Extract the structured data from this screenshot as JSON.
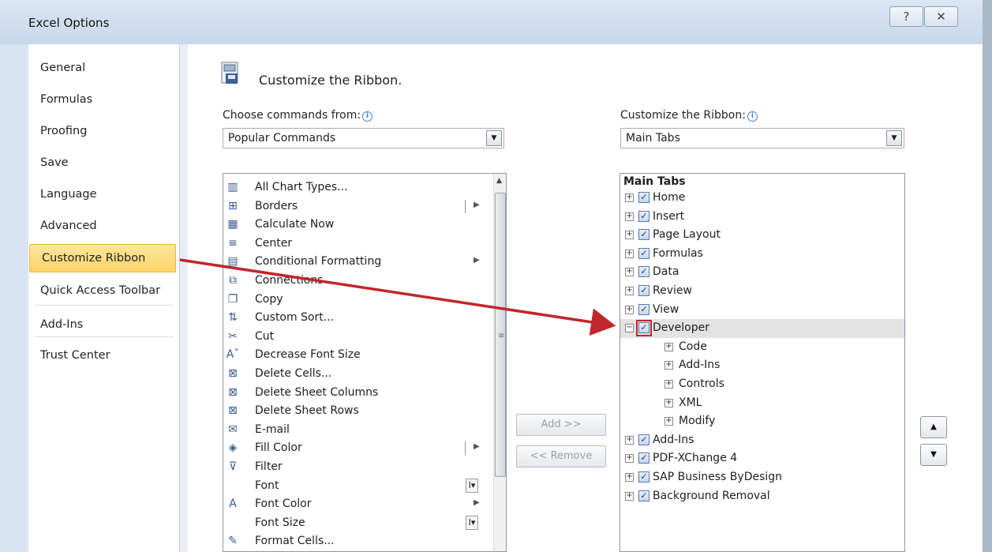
{
  "window": {
    "title": "Excel Options",
    "help_glyph": "?",
    "close_glyph": "✕"
  },
  "nav": {
    "items": [
      {
        "label": "General"
      },
      {
        "label": "Formulas"
      },
      {
        "label": "Proofing"
      },
      {
        "label": "Save"
      },
      {
        "label": "Language"
      },
      {
        "label": "Advanced"
      },
      {
        "label": "Customize Ribbon",
        "selected": true
      },
      {
        "label": "Quick Access Toolbar"
      },
      {
        "label": "Add-Ins"
      },
      {
        "label": "Trust Center"
      }
    ]
  },
  "header": {
    "title": "Customize the Ribbon."
  },
  "left": {
    "label": "Choose commands from:",
    "combo_value": "Popular Commands",
    "commands": [
      {
        "label": "All Chart Types...",
        "icon": "chart-icon",
        "glyph": "▥"
      },
      {
        "label": "Borders",
        "icon": "borders-icon",
        "glyph": "⊞",
        "submenu": true,
        "sep": true
      },
      {
        "label": "Calculate Now",
        "icon": "calculator-icon",
        "glyph": "▦"
      },
      {
        "label": "Center",
        "icon": "align-center-icon",
        "glyph": "≡"
      },
      {
        "label": "Conditional Formatting",
        "icon": "conditional-formatting-icon",
        "glyph": "▤",
        "submenu": true
      },
      {
        "label": "Connections",
        "icon": "connections-icon",
        "glyph": "⧉"
      },
      {
        "label": "Copy",
        "icon": "copy-icon",
        "glyph": "❐"
      },
      {
        "label": "Custom Sort...",
        "icon": "sort-icon",
        "glyph": "⇅"
      },
      {
        "label": "Cut",
        "icon": "scissors-icon",
        "glyph": "✂"
      },
      {
        "label": "Decrease Font Size",
        "icon": "decrease-font-icon",
        "glyph": "Aˇ"
      },
      {
        "label": "Delete Cells...",
        "icon": "delete-cells-icon",
        "glyph": "⊠"
      },
      {
        "label": "Delete Sheet Columns",
        "icon": "delete-columns-icon",
        "glyph": "⊠"
      },
      {
        "label": "Delete Sheet Rows",
        "icon": "delete-rows-icon",
        "glyph": "⊠"
      },
      {
        "label": "E-mail",
        "icon": "email-icon",
        "glyph": "✉"
      },
      {
        "label": "Fill Color",
        "icon": "fill-color-icon",
        "glyph": "◈",
        "submenu": true,
        "sep": true
      },
      {
        "label": "Filter",
        "icon": "filter-icon",
        "glyph": "⊽"
      },
      {
        "label": "Font",
        "icon": "",
        "glyph": "",
        "fontctl": true
      },
      {
        "label": "Font Color",
        "icon": "font-color-icon",
        "glyph": "A",
        "submenu": true
      },
      {
        "label": "Font Size",
        "icon": "",
        "glyph": "",
        "fontctl": true
      },
      {
        "label": "Format Cells...",
        "icon": "format-cells-icon",
        "glyph": "✎"
      }
    ]
  },
  "buttons": {
    "add": "Add >>",
    "remove": "<< Remove"
  },
  "right": {
    "label": "Customize the Ribbon:",
    "combo_value": "Main Tabs",
    "tree_header": "Main Tabs",
    "tabs": [
      {
        "label": "Home",
        "checked": true,
        "level": 0,
        "expander": "+"
      },
      {
        "label": "Insert",
        "checked": true,
        "level": 0,
        "expander": "+"
      },
      {
        "label": "Page Layout",
        "checked": true,
        "level": 0,
        "expander": "+"
      },
      {
        "label": "Formulas",
        "checked": true,
        "level": 0,
        "expander": "+"
      },
      {
        "label": "Data",
        "checked": true,
        "level": 0,
        "expander": "+"
      },
      {
        "label": "Review",
        "checked": true,
        "level": 0,
        "expander": "+"
      },
      {
        "label": "View",
        "checked": true,
        "level": 0,
        "expander": "+"
      },
      {
        "label": "Developer",
        "checked": true,
        "level": 0,
        "expander": "−",
        "selected": true,
        "highlighted": true
      },
      {
        "label": "Code",
        "level": 1,
        "expander": "+"
      },
      {
        "label": "Add-Ins",
        "level": 1,
        "expander": "+"
      },
      {
        "label": "Controls",
        "level": 1,
        "expander": "+"
      },
      {
        "label": "XML",
        "level": 1,
        "expander": "+"
      },
      {
        "label": "Modify",
        "level": 1,
        "expander": "+"
      },
      {
        "label": "Add-Ins",
        "checked": true,
        "level": 0,
        "expander": "+"
      },
      {
        "label": "PDF-XChange 4",
        "checked": true,
        "level": 0,
        "expander": "+"
      },
      {
        "label": "SAP Business ByDesign",
        "checked": true,
        "level": 0,
        "expander": "+"
      },
      {
        "label": "Background Removal",
        "checked": true,
        "level": 0,
        "expander": "+"
      }
    ]
  },
  "colors": {
    "accent": "#c0282d",
    "selected_nav": "#fbd46a"
  }
}
